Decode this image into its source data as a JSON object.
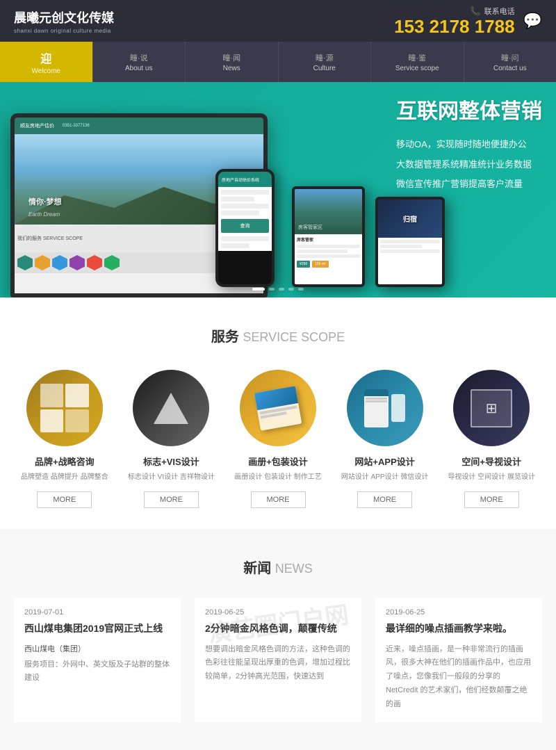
{
  "company": {
    "name_cn": "晨曦元创文化传媒",
    "name_en": "shanxi dawn original culture media",
    "contact_label": "联系电话",
    "phone": "153 2178 1788"
  },
  "nav": {
    "items": [
      {
        "id": "welcome",
        "cn": "迎",
        "dot": "·",
        "sub": "Welcome",
        "active": true
      },
      {
        "id": "about",
        "cn": "说",
        "dot": "·",
        "sub": "About us",
        "active": false
      },
      {
        "id": "news",
        "cn": "闻",
        "dot": "·",
        "sub": "News",
        "active": false
      },
      {
        "id": "culture",
        "cn": "源",
        "dot": "·",
        "sub": "Culture",
        "active": false
      },
      {
        "id": "scope",
        "cn": "鉴",
        "dot": "·",
        "sub": "Service scope",
        "active": false
      },
      {
        "id": "contact",
        "cn": "问",
        "dot": "·",
        "sub": "Contact us",
        "active": false
      }
    ]
  },
  "hero": {
    "title": "互联网整体营销",
    "lines": [
      "移动OA，实现随时随地便捷办公",
      "大数据管理系统精准统计业务数据",
      "微信宣传推广营销提高客户流量"
    ]
  },
  "services": {
    "section_title": "服务",
    "section_title_en": "SERVICE SCOPE",
    "items": [
      {
        "name": "品牌+战略咨询",
        "desc": "品牌塑造 品牌提升 品牌整合",
        "btn": "MORE"
      },
      {
        "name": "标志+VIS设计",
        "desc": "标志设计 VI设计 吉祥物设计",
        "btn": "MORE"
      },
      {
        "name": "画册+包装设计",
        "desc": "画册设计 包装设计 制作工艺",
        "btn": "MORE"
      },
      {
        "name": "网站+APP设计",
        "desc": "网站设计 APP设计 微信设计",
        "btn": "MORE"
      },
      {
        "name": "空间+导视设计",
        "desc": "导视设计 空间设计 展览设计",
        "btn": "MORE"
      }
    ]
  },
  "news": {
    "section_title": "新闻",
    "section_title_en": "NEWS",
    "items": [
      {
        "date": "2019-07-01",
        "title": "西山煤电集团2019官网正式上线",
        "company": "西山煤电（集团）",
        "desc": "服务项目：外网中、英文版及子站群的整体建设"
      },
      {
        "date": "2019-06-25",
        "title": "2分钟暗金风格色调，颠覆传统",
        "desc": "想要调出暗金风格色调的方法，这种色调的色彩往往能呈现出厚重的色调，增加过程比较简单，2分钟高光范围，快速达到"
      },
      {
        "date": "2019-06-25",
        "title": "最详细的噪点插画教学来啦。",
        "desc": "近来，噪点插画，是一种非常流行的插画风，很多大神在他们的插画作品中，也应用了噪点，您像我们一般段的分享的 NetCredit 的艺术家们，他们经数颠覆之绝的画"
      }
    ]
  },
  "watermark": "演艺圈门户网"
}
